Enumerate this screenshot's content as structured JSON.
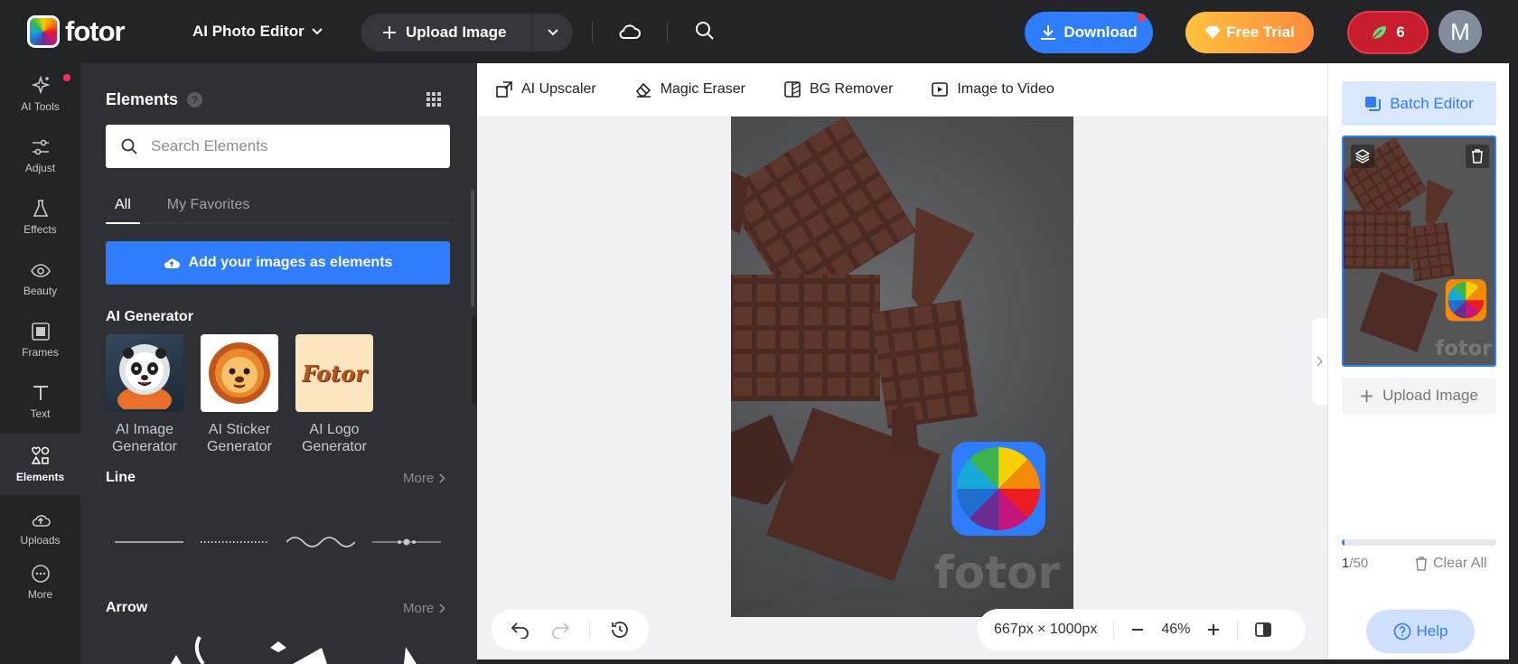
{
  "header": {
    "logo_text": "fotor",
    "app_title": "AI Photo Editor",
    "upload_label": "Upload Image",
    "download_label": "Download",
    "trial_label": "Free Trial",
    "credits": "6",
    "avatar_initial": "M"
  },
  "rail": {
    "items": [
      {
        "label": "AI Tools",
        "icon": "sparkle-icon"
      },
      {
        "label": "Adjust",
        "icon": "sliders-icon"
      },
      {
        "label": "Effects",
        "icon": "flask-icon"
      },
      {
        "label": "Beauty",
        "icon": "eye-icon"
      },
      {
        "label": "Frames",
        "icon": "frame-icon"
      },
      {
        "label": "Text",
        "icon": "text-icon"
      },
      {
        "label": "Elements",
        "icon": "shapes-icon"
      },
      {
        "label": "Uploads",
        "icon": "cloud-upload-icon"
      },
      {
        "label": "More",
        "icon": "more-icon"
      }
    ],
    "active": "Elements"
  },
  "panel": {
    "title": "Elements",
    "help": "?",
    "search_placeholder": "Search Elements",
    "tabs": [
      "All",
      "My Favorites"
    ],
    "active_tab": "All",
    "add_images_label": "Add your images as elements",
    "ai_generator_title": "AI Generator",
    "generators": [
      {
        "line1": "AI Image",
        "line2": "Generator"
      },
      {
        "line1": "AI Sticker",
        "line2": "Generator"
      },
      {
        "line1": "AI Logo",
        "line2": "Generator"
      }
    ],
    "logo_sample_text": "Fotor",
    "line_title": "Line",
    "arrow_title": "Arrow",
    "more_label": "More"
  },
  "toolstrip": {
    "tools": [
      {
        "label": "AI Upscaler",
        "icon": "upscale-icon"
      },
      {
        "label": "Magic Eraser",
        "icon": "eraser-icon"
      },
      {
        "label": "BG Remover",
        "icon": "bg-remove-icon"
      },
      {
        "label": "Image to Video",
        "icon": "video-icon"
      }
    ]
  },
  "canvas": {
    "dimensions": "667px × 1000px",
    "zoom": "46%",
    "watermark": "fotor"
  },
  "rightbar": {
    "batch_label": "Batch Editor",
    "upload_label": "Upload Image",
    "count_current": "1",
    "count_total": "/50",
    "clear_label": "Clear All",
    "help_label": "Help",
    "progress_fraction": 0.02
  },
  "colors": {
    "accent": "#2f7dff",
    "topbar": "#232428",
    "panel": "#2e3035",
    "credits": "#c81d2e",
    "trial_start": "#ffc23d",
    "trial_end": "#ff8a3d"
  }
}
